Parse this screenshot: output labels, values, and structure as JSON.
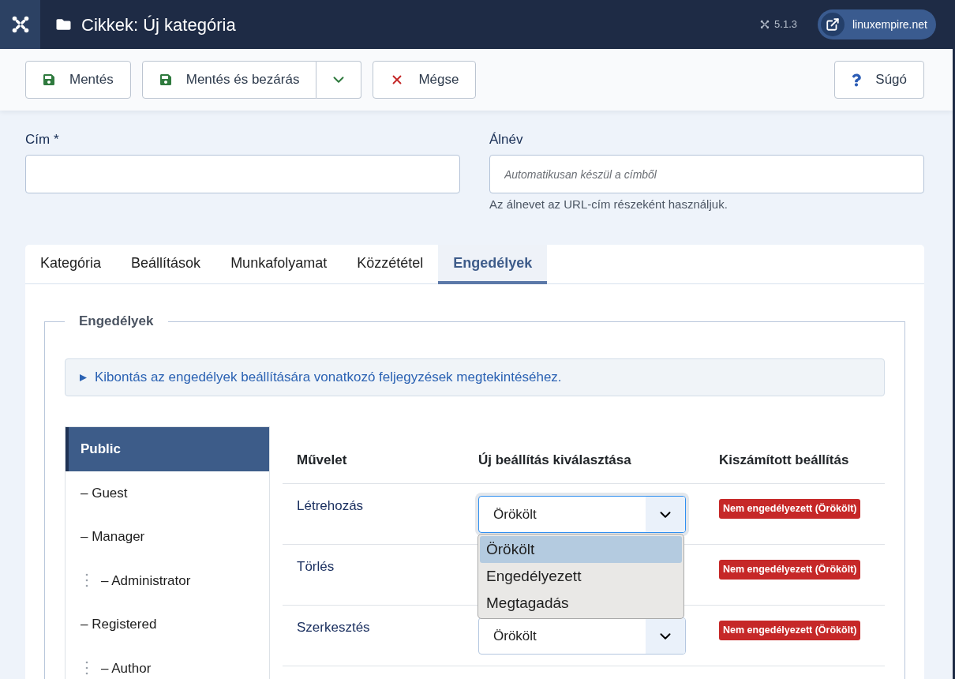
{
  "header": {
    "title": "Cikkek: Új kategória",
    "version": "5.1.3",
    "site_link": "linuxempire.net"
  },
  "toolbar": {
    "left": [
      {
        "kind": "save",
        "label": "Mentés"
      },
      {
        "kind": "save_close",
        "label": "Mentés és bezárás"
      },
      {
        "kind": "cancel",
        "label": "Mégse"
      }
    ],
    "right": [
      {
        "kind": "help",
        "label": "Súgó"
      }
    ]
  },
  "form": {
    "fields": [
      {
        "label": "Cím *"
      },
      {
        "label": "Álnév",
        "placeholder": "Automatikusan készül a címből",
        "hint": "Az álnevet az URL-cím részeként használjuk."
      }
    ]
  },
  "tabs": [
    {
      "label": "Kategória",
      "selected": false
    },
    {
      "label": "Beállítások",
      "selected": false
    },
    {
      "label": "Munkafolyamat",
      "selected": false
    },
    {
      "label": "Közzététel",
      "selected": false
    },
    {
      "label": "Engedélyek",
      "selected": true
    }
  ],
  "permissions": {
    "legend": "Engedélyek",
    "notes_toggle": "Kibontás az engedélyek beállítására vonatkozó feljegyzések megtekintéséhez.",
    "groups": [
      {
        "label": "Public",
        "selected": true,
        "children": [
          {
            "label": "– Guest",
            "selected": false
          },
          {
            "label": "– Manager",
            "selected": false,
            "children": [
              {
                "label": "– Administrator",
                "selected": false
              }
            ]
          },
          {
            "label": "– Registered",
            "selected": false,
            "children": [
              {
                "label": "– Author",
                "selected": false
              }
            ]
          }
        ]
      }
    ],
    "table": {
      "columns": [
        "Művelet",
        "Új beállítás kiválasztása",
        "Kiszámított beállítás"
      ],
      "rows": [
        {
          "action": "Létrehozás",
          "setting": {
            "value": "Örökölt",
            "expanded": true,
            "options": [
              {
                "label": "Örökölt",
                "selected": true
              },
              {
                "label": "Engedélyezett",
                "selected": false
              },
              {
                "label": "Megtagadás",
                "selected": false
              }
            ]
          },
          "calculated": "Nem engedélyezett (Örökölt)"
        },
        {
          "action": "Törlés",
          "calculated": "Nem engedélyezett (Örökölt)"
        },
        {
          "action": "Szerkesztés",
          "setting": {
            "value": "Örökölt",
            "expanded": false
          },
          "calculated": "Nem engedélyezett (Örökölt)"
        }
      ]
    }
  }
}
